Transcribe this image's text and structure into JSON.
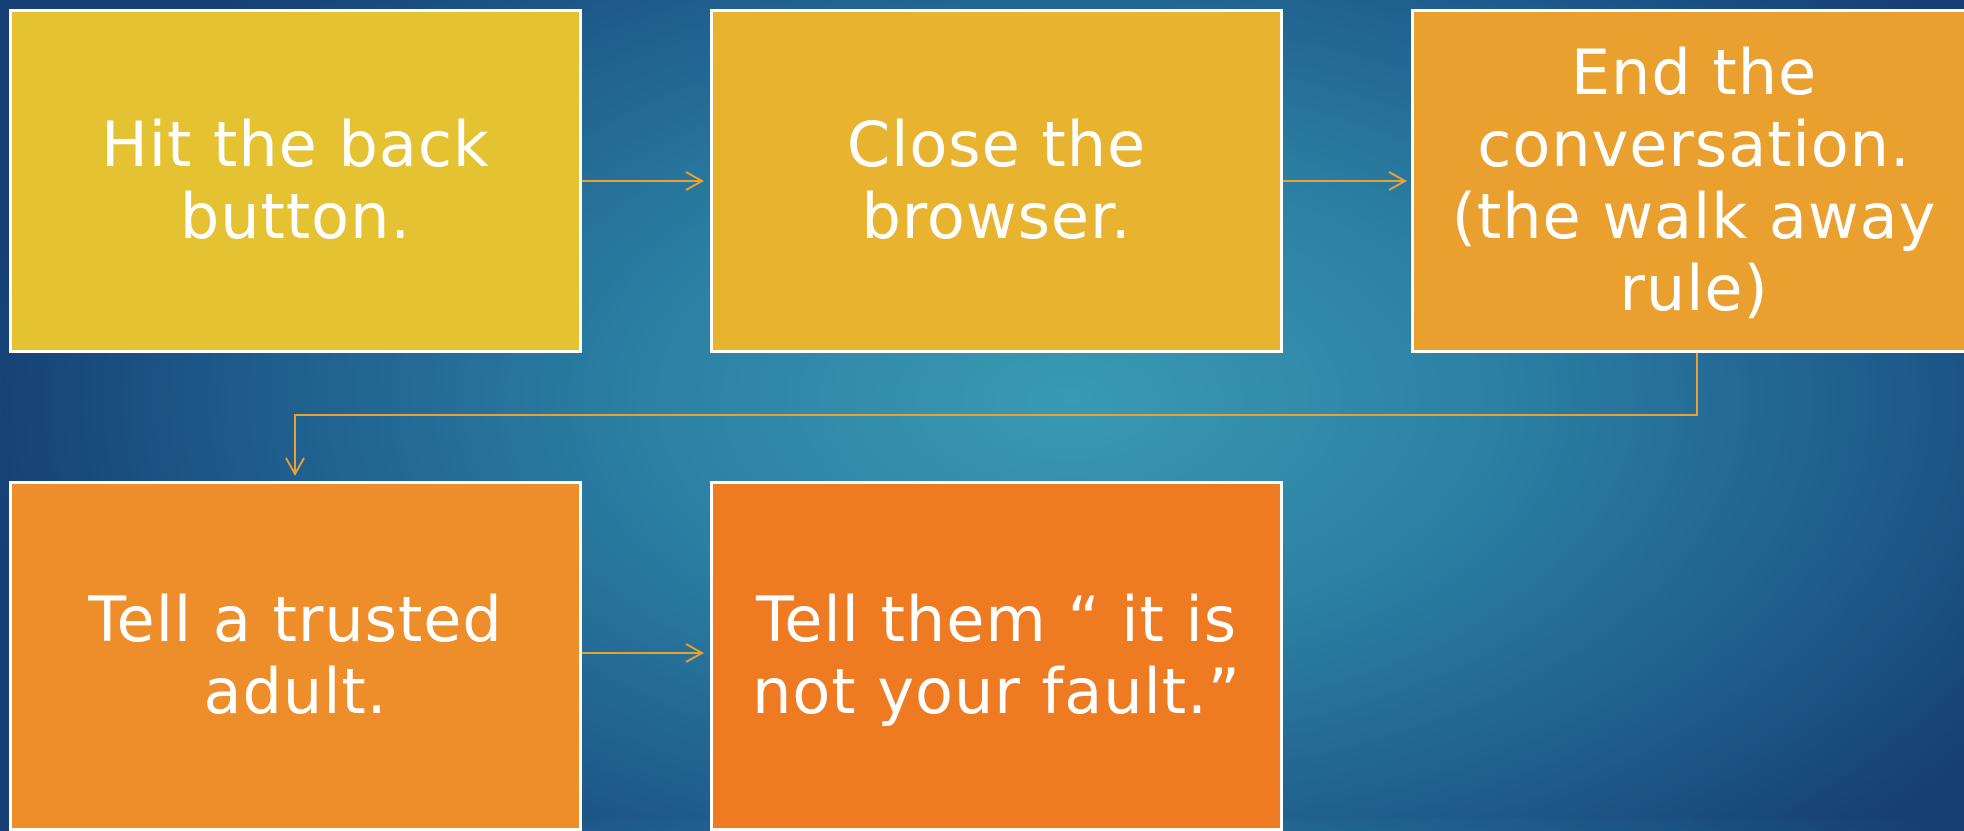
{
  "colors": {
    "box1": "#e5c232",
    "box2": "#e8b430",
    "box3": "#e9a02f",
    "box4": "#ee8e2a",
    "box5": "#ee7b22",
    "arrow": "#e9a134",
    "border": "#ffffff"
  },
  "steps": [
    {
      "text": "Hit the back button."
    },
    {
      "text": "Close the browser."
    },
    {
      "text": "End the conversation. (the walk away rule)"
    },
    {
      "text": "Tell a trusted adult."
    },
    {
      "text": "Tell them “ it is not your fault.”"
    }
  ]
}
